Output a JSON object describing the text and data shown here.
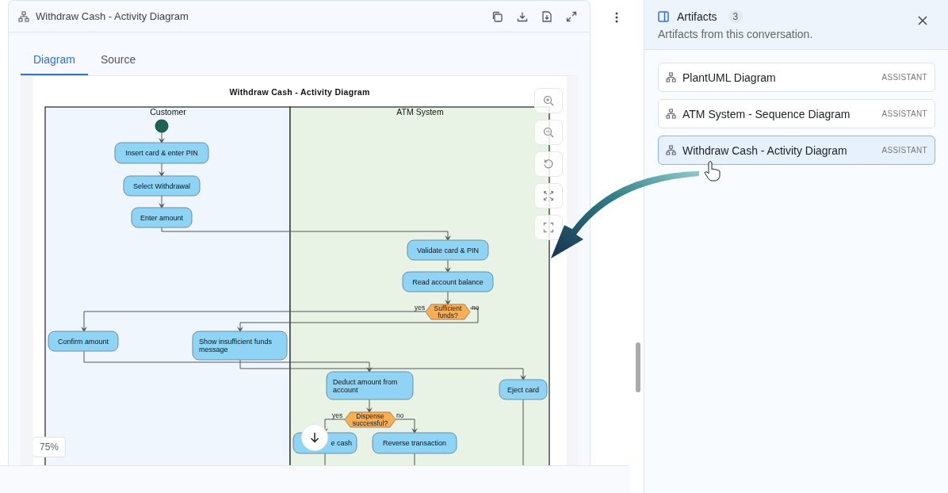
{
  "artifact_panel": {
    "title": "Withdraw Cash - Activity Diagram"
  },
  "tabs": [
    {
      "label": "Diagram",
      "selected": true
    },
    {
      "label": "Source",
      "selected": false
    }
  ],
  "diagram": {
    "title": "Withdraw Cash - Activity Diagram",
    "lanes": [
      "Customer",
      "ATM System"
    ],
    "nodes": [
      {
        "kind": "action",
        "lines": [
          "Insert card & enter PIN"
        ]
      },
      {
        "kind": "action",
        "lines": [
          "Select Withdrawal"
        ]
      },
      {
        "kind": "action",
        "lines": [
          "Enter amount"
        ]
      },
      {
        "kind": "action",
        "lines": [
          "Validate card & PIN"
        ]
      },
      {
        "kind": "action",
        "lines": [
          "Read account balance"
        ]
      },
      {
        "kind": "decision",
        "lines": [
          "Sufficient",
          "funds?"
        ],
        "yes": "yes",
        "no": "no"
      },
      {
        "kind": "action",
        "lines": [
          "Confirm amount"
        ]
      },
      {
        "kind": "action",
        "lines": [
          "Show insufficient funds",
          "message"
        ]
      },
      {
        "kind": "action",
        "lines": [
          "Deduct amount from",
          "account"
        ]
      },
      {
        "kind": "action",
        "lines": [
          "Eject card"
        ]
      },
      {
        "kind": "decision",
        "lines": [
          "Dispense",
          "successful?"
        ],
        "yes": "yes",
        "no": "no"
      },
      {
        "kind": "action",
        "lines": [
          "e cash"
        ]
      },
      {
        "kind": "action",
        "lines": [
          "Reverse transaction"
        ]
      }
    ],
    "zoom": "75%"
  },
  "sidebar": {
    "title": "Artifacts",
    "count": "3",
    "subtitle": "Artifacts from this conversation.",
    "items": [
      {
        "label": "PlantUML Diagram",
        "tag": "ASSISTANT",
        "selected": false
      },
      {
        "label": "ATM System - Sequence Diagram",
        "tag": "ASSISTANT",
        "selected": false
      },
      {
        "label": "Withdraw Cash - Activity Diagram",
        "tag": "ASSISTANT",
        "selected": true
      }
    ]
  }
}
